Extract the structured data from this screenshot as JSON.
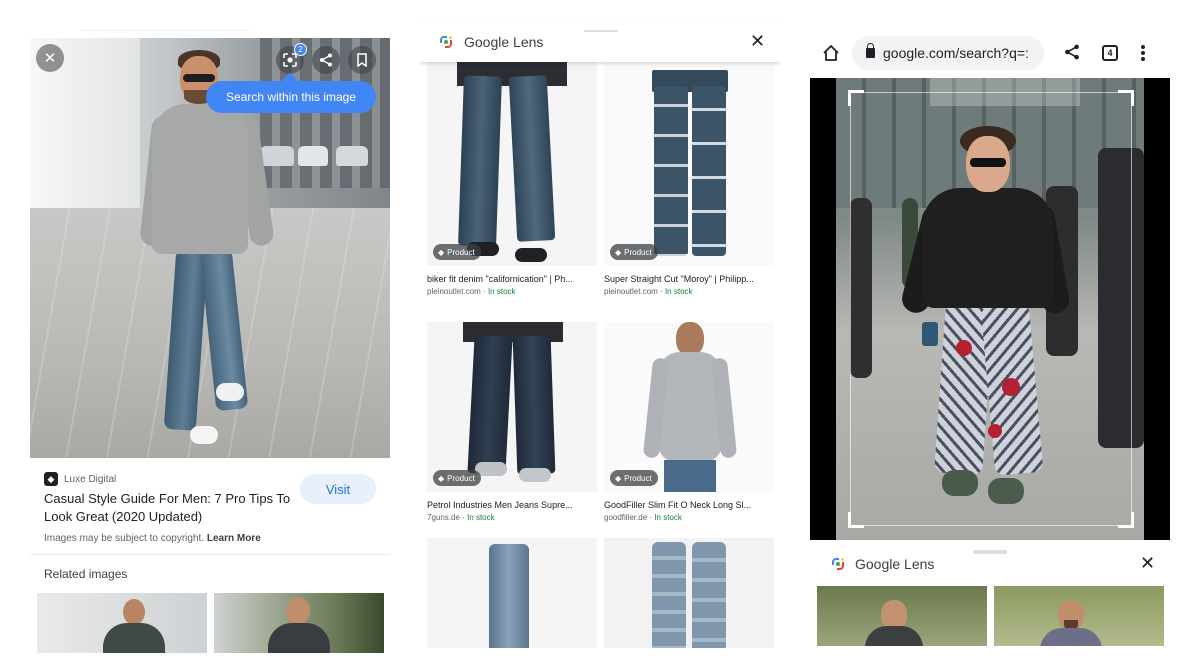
{
  "panel1": {
    "tooltip": "Search within this image",
    "lens_badge_count": "2",
    "source_name": "Luxe Digital",
    "title": "Casual Style Guide For Men: 7 Pro Tips To Look Great (2020 Updated)",
    "visit_label": "Visit",
    "copyright_text": "Images may be subject to copyright.",
    "learn_more": "Learn More",
    "related_heading": "Related images"
  },
  "lens_sheet": {
    "brand": "Google Lens",
    "products": [
      {
        "tag": "Product",
        "name": "biker fit denim \"californication\" | Ph...",
        "site": "pleinoutlet.com",
        "stock": "In stock"
      },
      {
        "tag": "Product",
        "name": "Super Straight Cut \"Moroy\" | Philipp...",
        "site": "pleinoutlet.com",
        "stock": "In stock"
      },
      {
        "tag": "Product",
        "name": "Petrol Industries Men Jeans Supre...",
        "site": "7guns.de",
        "stock": "In stock"
      },
      {
        "tag": "Product",
        "name": "GoodFiller Slim Fit O Neck Long Sl...",
        "site": "goodfiller.de",
        "stock": "In stock"
      }
    ],
    "separator": "·"
  },
  "browser": {
    "url": "google.com/search?q=:",
    "tab_count": "4",
    "sheet_brand": "Google Lens"
  },
  "colors": {
    "accent": "#4285f4",
    "link": "#1a73e8",
    "in_stock": "#188038"
  },
  "icons": [
    "close-icon",
    "lens-icon",
    "share-icon",
    "bookmark-icon",
    "tag-icon",
    "home-icon",
    "lock-icon",
    "more-vert-icon"
  ]
}
